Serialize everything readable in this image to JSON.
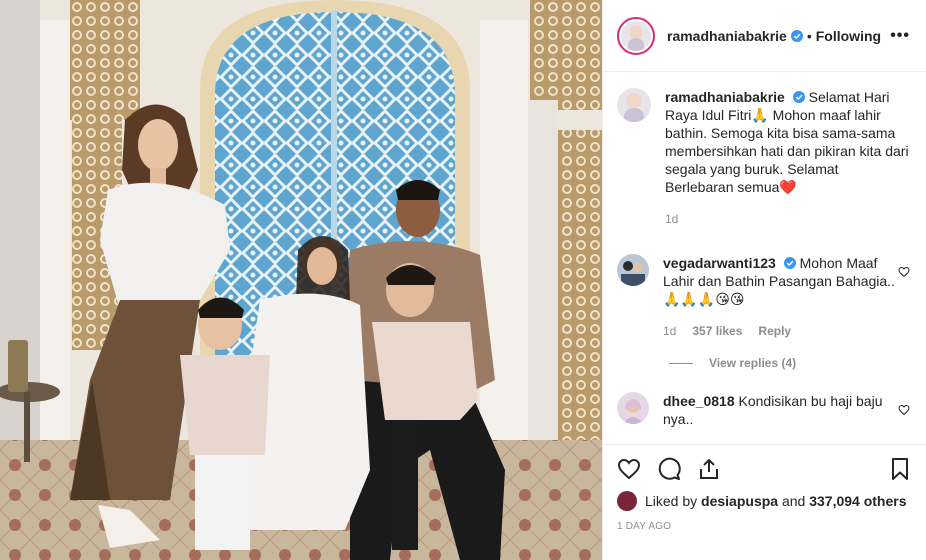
{
  "post": {
    "image_alt": "",
    "author": {
      "username": "ramadhaniabakrie",
      "verified": true,
      "following_label": "Following",
      "separator": "•"
    },
    "caption": {
      "username": "ramadhaniabakrie",
      "text": "Selamat Hari Raya Idul Fitri🙏 Mohon maaf lahir bathin. Semoga kita bisa sama-sama membersihkan hati dan pikiran kita dari segala yang buruk. Selamat Berlebaran semua❤️",
      "age": "1d"
    },
    "comments": [
      {
        "username": "vegadarwanti123",
        "verified": true,
        "text": "Mohon Maaf Lahir dan Bathin Pasangan Bahagia.. 🙏🙏🙏😘😘",
        "age": "1d",
        "likes": "357 likes",
        "reply_label": "Reply",
        "view_replies": "View replies (4)"
      },
      {
        "username": "dhee_0818",
        "verified": false,
        "text": "Kondisikan bu haji baju nya..",
        "age": "",
        "likes": "",
        "reply_label": ""
      }
    ],
    "liked_by": {
      "prefix": "Liked by",
      "user": "desiapuspa",
      "connector": "and",
      "others": "337,094 others"
    },
    "time_ago": "1 DAY AGO"
  },
  "colors": {
    "verified": "#3897f0",
    "heart": "#ed4956",
    "muted": "#8e8e8e",
    "text": "#262626"
  },
  "icons": [
    "more-icon",
    "verified-icon",
    "heart-icon",
    "comment-icon",
    "share-icon",
    "bookmark-icon"
  ]
}
